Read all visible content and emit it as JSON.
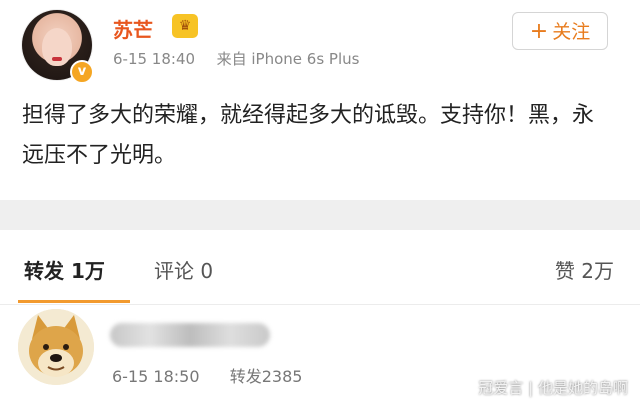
{
  "post": {
    "author": "苏芒",
    "timestamp": "6-15 18:40",
    "source": "来自 iPhone 6s Plus",
    "follow_label": "关注",
    "content": "担得了多大的荣耀，就经得起多大的诋毁。支持你！黑，永远压不了光明。"
  },
  "tabs": {
    "repost": "转发 1万",
    "comment": "评论 0",
    "like": "赞 2万"
  },
  "repost_item": {
    "timestamp": "6-15 18:50",
    "reposts": "转发2385"
  },
  "watermark": "冠爱言 | 他是她的岛啊",
  "colors": {
    "username": "#e8561e",
    "follow": "#e87c1e",
    "tab_underline": "#f29a2e",
    "verified_badge": "#f5a623"
  }
}
